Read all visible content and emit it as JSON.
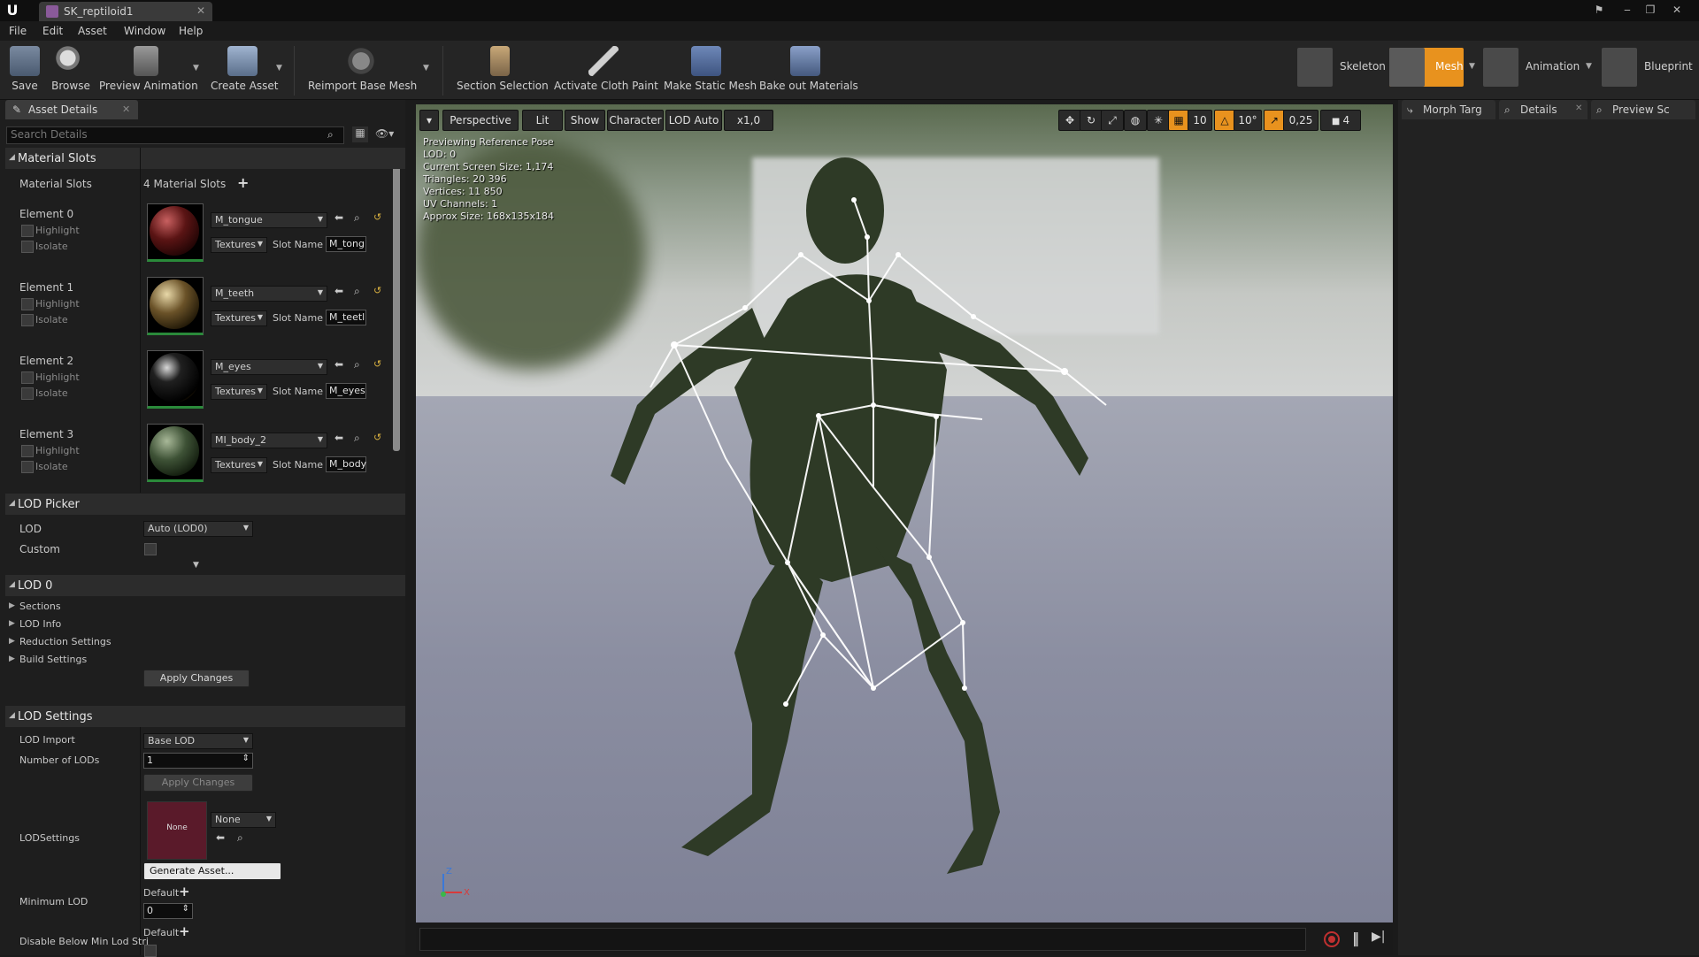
{
  "window": {
    "tab_title": "SK_reptiloid1"
  },
  "menu": [
    "File",
    "Edit",
    "Asset",
    "Window",
    "Help"
  ],
  "toolbar": {
    "buttons": [
      {
        "label": "Save",
        "icon": "save-icon"
      },
      {
        "label": "Browse",
        "icon": "browse-icon"
      },
      {
        "label": "Preview Animation",
        "icon": "preview-animation-icon"
      },
      {
        "label": "Create Asset",
        "icon": "create-asset-icon"
      },
      {
        "label": "Reimport Base Mesh",
        "icon": "reimport-icon"
      },
      {
        "label": "Section Selection",
        "icon": "section-selection-icon"
      },
      {
        "label": "Activate Cloth Paint",
        "icon": "cloth-paint-icon"
      },
      {
        "label": "Make Static Mesh",
        "icon": "static-mesh-icon"
      },
      {
        "label": "Bake out Materials",
        "icon": "bake-materials-icon"
      }
    ],
    "modes": [
      {
        "label": "Skeleton",
        "active": false
      },
      {
        "label": "Mesh",
        "active": true
      },
      {
        "label": "Animation",
        "active": false
      },
      {
        "label": "Blueprint",
        "active": false
      }
    ]
  },
  "left_panel": {
    "tab": "Asset Details",
    "search_placeholder": "Search Details",
    "material_slots": {
      "header": "Material Slots",
      "label": "Material Slots",
      "count": "4 Material Slots",
      "elements": [
        {
          "label": "Element 0",
          "material": "M_tongue",
          "textures": "Textures",
          "slot_name_label": "Slot Name",
          "slot_name": "M_tong",
          "highlight": "Highlight",
          "isolate": "Isolate",
          "color": "#5a1414"
        },
        {
          "label": "Element 1",
          "material": "M_teeth",
          "textures": "Textures",
          "slot_name_label": "Slot Name",
          "slot_name": "M_teetl",
          "highlight": "Highlight",
          "isolate": "Isolate",
          "color": "#6a5228"
        },
        {
          "label": "Element 2",
          "material": "M_eyes",
          "textures": "Textures",
          "slot_name_label": "Slot Name",
          "slot_name": "M_eyes",
          "highlight": "Highlight",
          "isolate": "Isolate",
          "color": "#141414"
        },
        {
          "label": "Element 3",
          "material": "MI_body_2",
          "textures": "Textures",
          "slot_name_label": "Slot Name",
          "slot_name": "M_body",
          "highlight": "Highlight",
          "isolate": "Isolate",
          "color": "#3e5236"
        }
      ]
    },
    "lod_picker": {
      "header": "LOD Picker",
      "lod_label": "LOD",
      "lod_value": "Auto (LOD0)",
      "custom_label": "Custom"
    },
    "lod0": {
      "header": "LOD 0",
      "items": [
        "Sections",
        "LOD Info",
        "Reduction Settings",
        "Build Settings"
      ],
      "apply": "Apply Changes"
    },
    "lod_settings": {
      "header": "LOD Settings",
      "lod_import_label": "LOD Import",
      "lod_import_value": "Base LOD",
      "num_lods_label": "Number of LODs",
      "num_lods_value": "1",
      "apply": "Apply Changes",
      "lodsettings_label": "LODSettings",
      "lodsettings_thumb": "None",
      "lodsettings_value": "None",
      "generate": "Generate Asset...",
      "min_lod_label": "Minimum LOD",
      "min_lod_default": "Default",
      "min_lod_value": "0",
      "disable_label": "Disable Below Min Lod Stri",
      "disable_default": "Default"
    }
  },
  "viewport": {
    "buttons": {
      "perspective": "Perspective",
      "lit": "Lit",
      "show": "Show",
      "character": "Character",
      "lod": "LOD Auto",
      "speed": "x1,0"
    },
    "right_controls": {
      "grid": "10",
      "angle": "10°",
      "scale": "0,25",
      "camera": "4"
    },
    "info": [
      "Previewing Reference Pose",
      "LOD: 0",
      "Current Screen Size: 1,174",
      "Triangles: 20 396",
      "Vertices: 11 850",
      "UV Channels: 1",
      "Approx Size: 168x135x184"
    ],
    "axis": {
      "z": "Z",
      "x": "X"
    }
  },
  "right_panel": {
    "tabs": [
      "Morph Targ",
      "Details",
      "Preview Sc"
    ]
  }
}
